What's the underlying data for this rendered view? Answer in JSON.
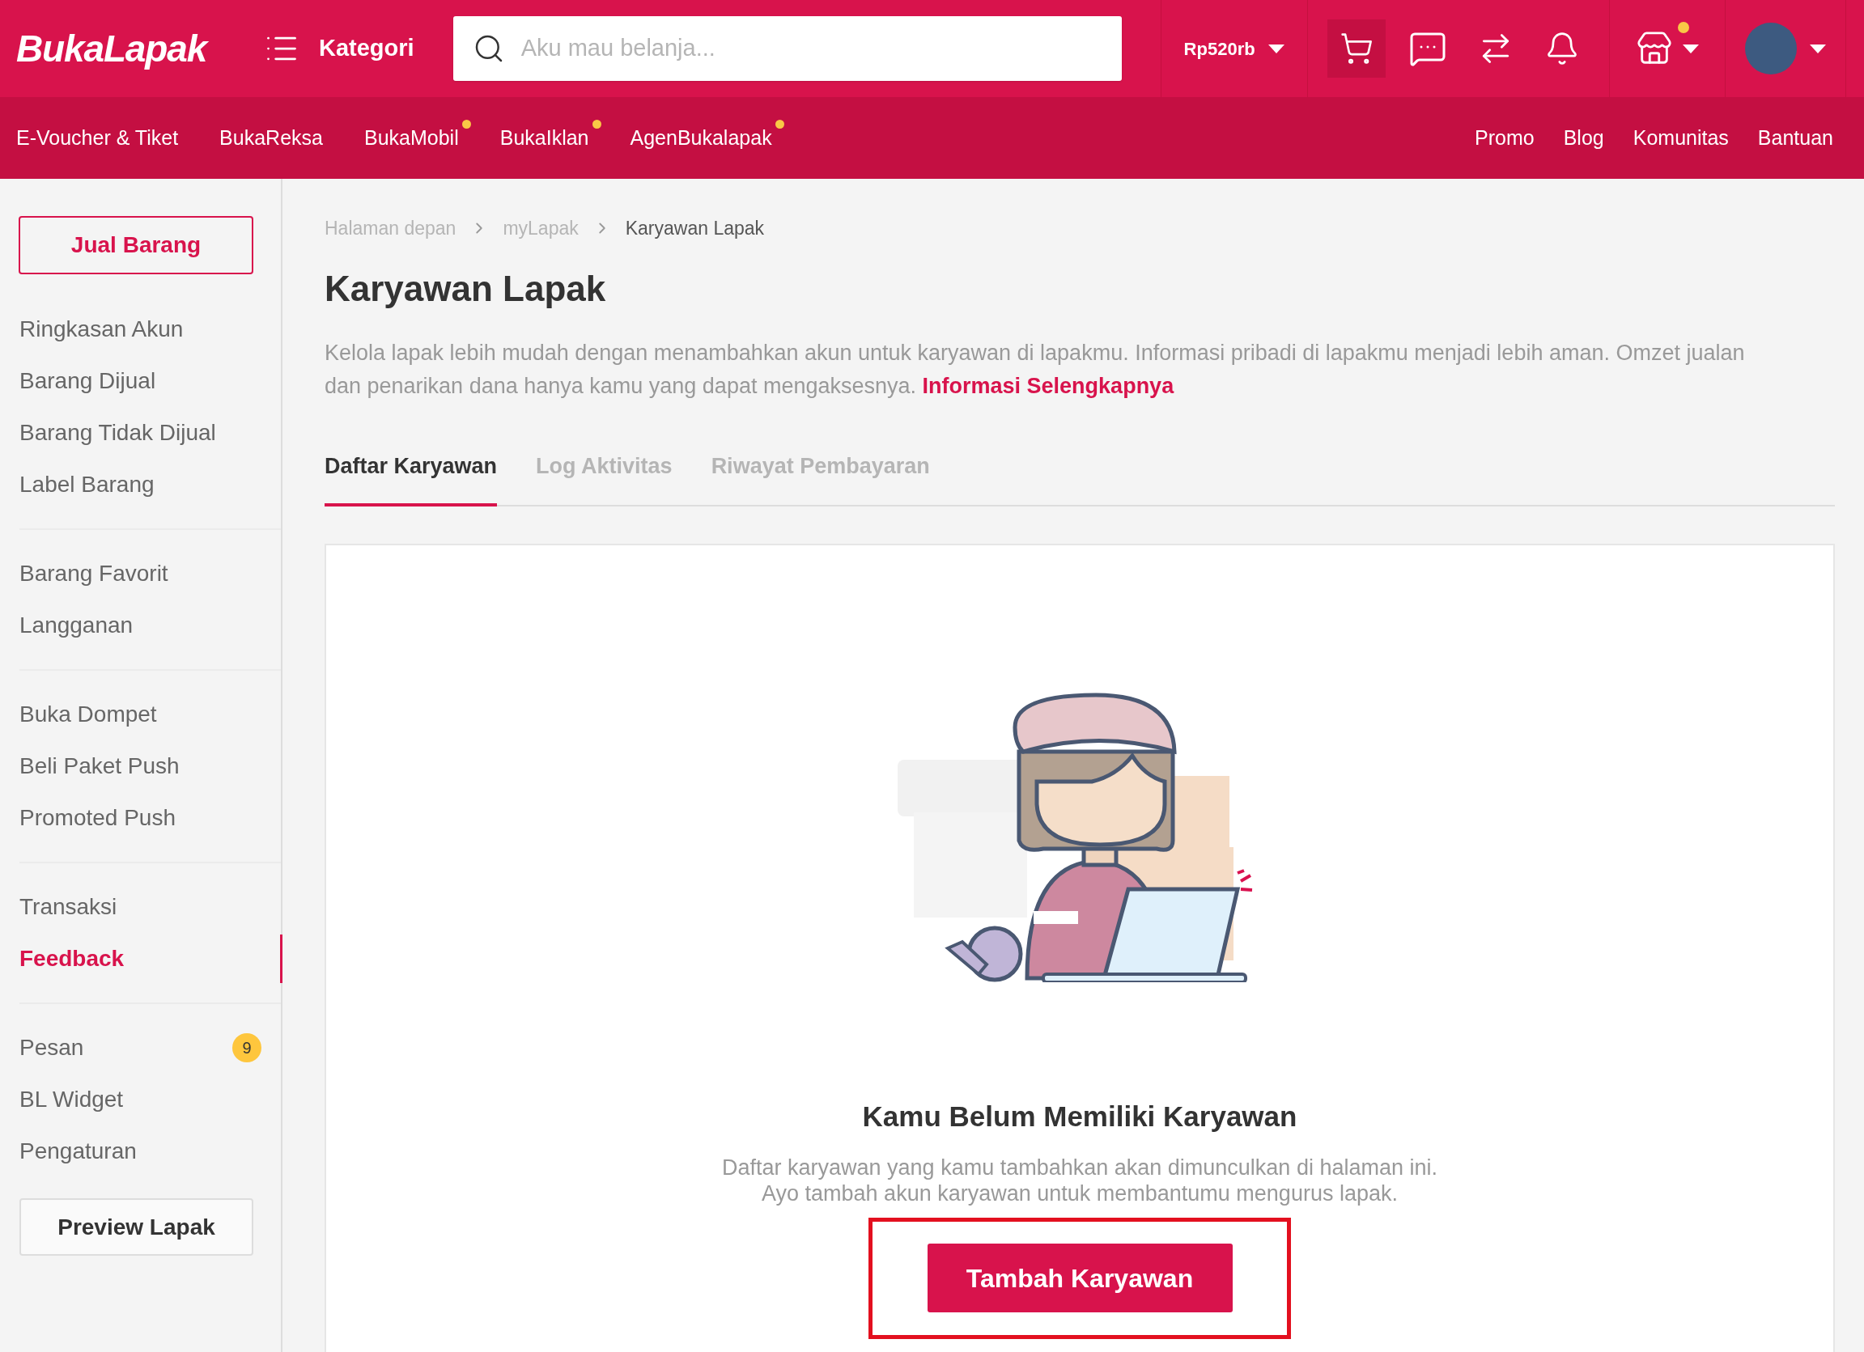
{
  "header": {
    "logo": "BukaLapak",
    "category_button": "Kategori",
    "search": {
      "placeholder": "Aku mau belanja..."
    },
    "balance": "Rp520rb",
    "cart_active": true,
    "store_notification": true
  },
  "nav": {
    "left": [
      {
        "label": "E-Voucher & Tiket",
        "new": false
      },
      {
        "label": "BukaReksa",
        "new": false
      },
      {
        "label": "BukaMobil",
        "new": true
      },
      {
        "label": "BukaIklan",
        "new": true
      },
      {
        "label": "AgenBukalapak",
        "new": true
      }
    ],
    "right": [
      "Promo",
      "Blog",
      "Komunitas",
      "Bantuan"
    ]
  },
  "sidebar": {
    "sell_button": "Jual Barang",
    "groups": [
      [
        {
          "label": "Ringkasan Akun",
          "selected": false
        },
        {
          "label": "Barang Dijual",
          "selected": false
        },
        {
          "label": "Barang Tidak Dijual",
          "selected": false
        },
        {
          "label": "Label Barang",
          "selected": false
        }
      ],
      [
        {
          "label": "Barang Favorit",
          "selected": false
        },
        {
          "label": "Langganan",
          "selected": false
        }
      ],
      [
        {
          "label": "Buka Dompet",
          "selected": false
        },
        {
          "label": "Beli Paket Push",
          "selected": false
        },
        {
          "label": "Promoted Push",
          "selected": false
        }
      ],
      [
        {
          "label": "Transaksi",
          "selected": false
        },
        {
          "label": "Feedback",
          "selected": true
        }
      ],
      [
        {
          "label": "Pesan",
          "selected": false,
          "badge": "9"
        },
        {
          "label": "BL Widget",
          "selected": false
        },
        {
          "label": "Pengaturan",
          "selected": false
        }
      ]
    ],
    "preview_button": "Preview Lapak"
  },
  "breadcrumb": [
    "Halaman depan",
    "myLapak",
    "Karyawan Lapak"
  ],
  "title": "Karyawan Lapak",
  "description": "Kelola lapak lebih mudah dengan menambahkan akun untuk karyawan di lapakmu. Informasi pribadi di lapakmu menjadi lebih aman. Omzet jualan dan penarikan dana hanya kamu yang dapat mengaksesnya.",
  "description_link": "Informasi Selengkapnya",
  "tabs": [
    {
      "label": "Daftar Karyawan",
      "selected": true
    },
    {
      "label": "Log Aktivitas",
      "selected": false
    },
    {
      "label": "Riwayat Pembayaran",
      "selected": false
    }
  ],
  "empty_state": {
    "title": "Kamu Belum Memiliki Karyawan",
    "lines": [
      "Daftar karyawan yang kamu tambahkan akan dimunculkan di halaman ini.",
      "Ayo tambah akun karyawan untuk membantumu mengurus lapak."
    ],
    "button": "Tambah Karyawan",
    "highlighted": true
  }
}
